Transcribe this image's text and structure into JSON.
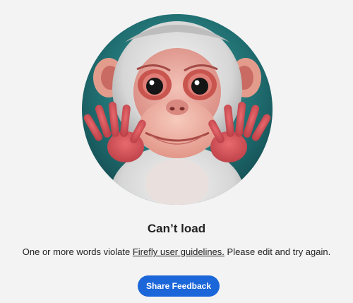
{
  "empty_state": {
    "illustration_icon": "monkey-shrug-illustration",
    "title": "Can’t load",
    "message_before": "One or more words violate ",
    "guidelines_link": "Firefly user guidelines.",
    "message_after": " Please edit and try again."
  },
  "actions": {
    "share_feedback_label": "Share Feedback"
  },
  "colors": {
    "background": "#f3f3f3",
    "button": "#1b66d8",
    "illustration_bg": "#1f6d70"
  }
}
